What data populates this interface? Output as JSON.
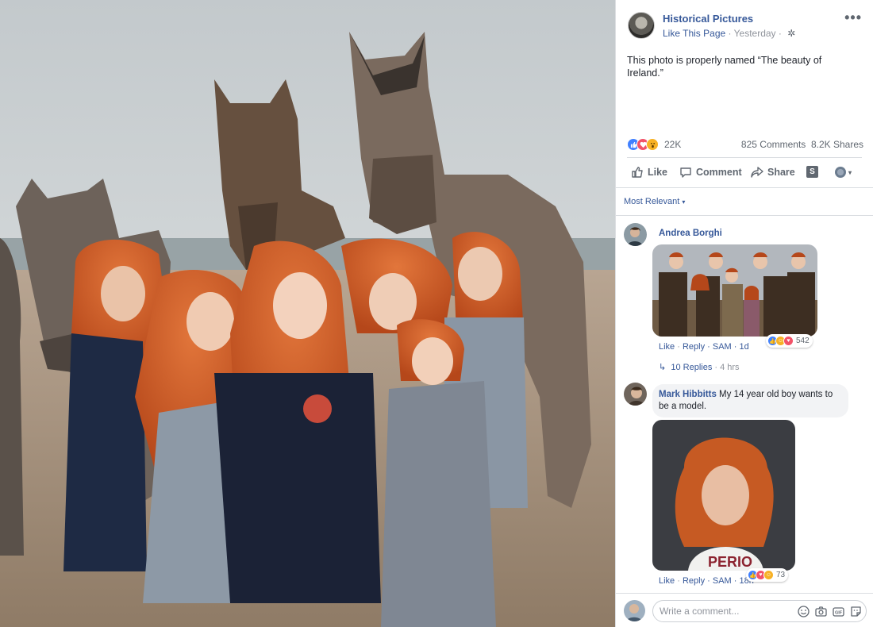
{
  "post": {
    "page_name": "Historical Pictures",
    "like_page": "Like This Page",
    "separator": " · ",
    "time": "Yesterday",
    "separator2": " · ",
    "more_label": "•••",
    "text": "This photo is properly named “The beauty of Ireland.”"
  },
  "stats": {
    "reaction_count": "22K",
    "comments_shares": "825 Comments  8.2K Shares"
  },
  "actions": {
    "like": "Like",
    "comment": "Comment",
    "share": "Share",
    "s_label": "S",
    "caret": "▾"
  },
  "sort": {
    "label": "Most Relevant",
    "caret": "▾"
  },
  "comments": [
    {
      "author": "Andrea Borghi",
      "like": "Like",
      "reply": "Reply",
      "sep": " · ",
      "tail": " · SAM · 1d",
      "reaction_count": "542",
      "replies": "10 Replies",
      "replies_time": " · 4 hrs"
    },
    {
      "author": "Mark Hibbitts",
      "text": " My 14 year old boy wants to be a model.",
      "like": "Like",
      "reply": "Reply",
      "sep": " · ",
      "tail": " · SAM · 18h",
      "reaction_count": "73"
    }
  ],
  "composer": {
    "placeholder": "Write a comment..."
  },
  "colors": {
    "link": "#365899",
    "meta": "#90949c",
    "like_blue": "#4080ff",
    "love_red": "#f25268",
    "wow_yellow": "#f7b125"
  }
}
